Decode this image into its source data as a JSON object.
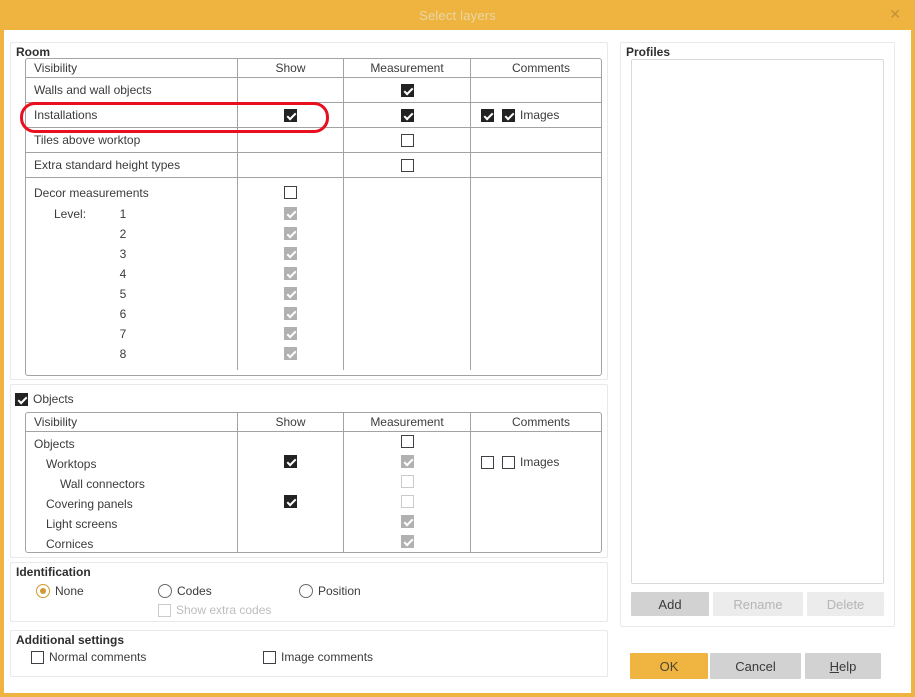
{
  "colors": {
    "accent": "#efb440",
    "highlight": "#e8101f"
  },
  "titlebar": {
    "title": "Select layers",
    "close_glyph": "✕"
  },
  "room": {
    "label": "Room",
    "headers": {
      "visibility": "Visibility",
      "show": "Show",
      "measurement": "Measurement",
      "comments": "Comments"
    },
    "rows": [
      {
        "label": "Walls and wall objects",
        "measurement_checked": true
      },
      {
        "label": "Installations",
        "show_checked": true,
        "measurement_checked": true,
        "comment_checked": true,
        "comment_images_checked": true,
        "images_label": "Images",
        "highlighted": true
      },
      {
        "label": "Tiles above worktop",
        "measurement_checked": false
      },
      {
        "label": "Extra standard height types",
        "measurement_checked": false
      }
    ],
    "decor": {
      "label": "Decor measurements",
      "show_checked": false,
      "level_label": "Level:",
      "levels": [
        {
          "num": "1",
          "checked": true,
          "disabled": true
        },
        {
          "num": "2",
          "checked": true,
          "disabled": true
        },
        {
          "num": "3",
          "checked": true,
          "disabled": true
        },
        {
          "num": "4",
          "checked": true,
          "disabled": true
        },
        {
          "num": "5",
          "checked": true,
          "disabled": true
        },
        {
          "num": "6",
          "checked": true,
          "disabled": true
        },
        {
          "num": "7",
          "checked": true,
          "disabled": true
        },
        {
          "num": "8",
          "checked": true,
          "disabled": true
        }
      ]
    }
  },
  "objects": {
    "label": "Objects",
    "section_checked": true,
    "headers": {
      "visibility": "Visibility",
      "show": "Show",
      "measurement": "Measurement",
      "comments": "Comments"
    },
    "rows": [
      {
        "label": "Objects",
        "measurement_checked": false,
        "measurement_disabled": false
      },
      {
        "label": "Worktops",
        "show_checked": true,
        "measurement_checked": true,
        "measurement_disabled": true
      },
      {
        "label": "Wall connectors",
        "measurement_checked": false,
        "measurement_disabled": true
      },
      {
        "label": "Covering panels",
        "show_checked": true,
        "measurement_checked": false,
        "measurement_disabled": true
      },
      {
        "label": "Light screens",
        "measurement_checked": true,
        "measurement_disabled": true
      },
      {
        "label": "Cornices",
        "measurement_checked": true,
        "measurement_disabled": true
      }
    ],
    "comments": {
      "box_checked": false,
      "images_checked": false,
      "images_label": "Images"
    }
  },
  "identification": {
    "label": "Identification",
    "options": [
      {
        "label": "None",
        "selected": true
      },
      {
        "label": "Codes",
        "selected": false
      },
      {
        "label": "Position",
        "selected": false
      }
    ],
    "show_extra_codes": {
      "label": "Show extra codes",
      "checked": false,
      "disabled": true
    }
  },
  "additional": {
    "label": "Additional settings",
    "normal_comments": {
      "label": "Normal comments",
      "checked": false
    },
    "image_comments": {
      "label": "Image comments",
      "checked": false
    }
  },
  "profiles": {
    "label": "Profiles",
    "items": [],
    "add_label": "Add",
    "rename_label": "Rename",
    "delete_label": "Delete"
  },
  "footer": {
    "ok_label": "OK",
    "cancel_label": "Cancel",
    "help_accelerator": "H",
    "help_rest": "elp"
  }
}
